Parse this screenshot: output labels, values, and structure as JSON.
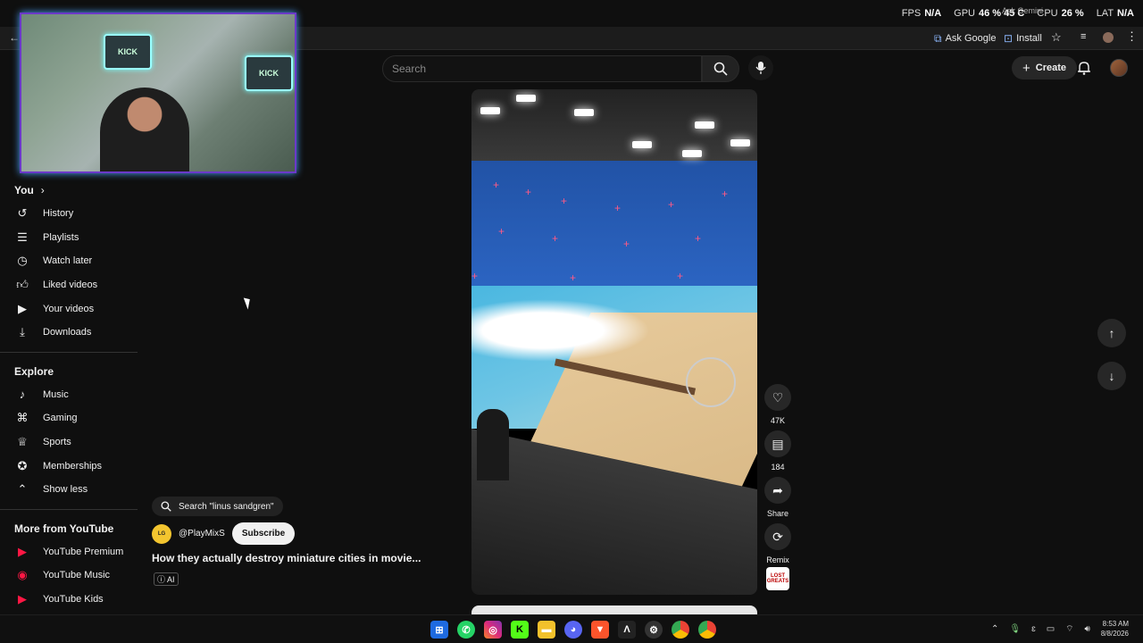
{
  "overlay": {
    "fps_label": "FPS",
    "fps_value": "N/A",
    "gpu_label": "GPU",
    "gpu_value": "46 % 45 C",
    "cpu_label": "CPU",
    "cpu_value": "26 %",
    "lat_label": "LAT",
    "lat_value": "N/A",
    "gemini": "Ask Gemini"
  },
  "browser": {
    "ask_google": "Ask Google",
    "install": "Install"
  },
  "header": {
    "search_placeholder": "Search",
    "create_label": "Create"
  },
  "webcam": {
    "sign1": "KICK",
    "sign2": "KICK"
  },
  "sidebar": {
    "you_title": "You",
    "you_items": [
      {
        "label": "History",
        "icon": "history-icon"
      },
      {
        "label": "Playlists",
        "icon": "playlists-icon"
      },
      {
        "label": "Watch later",
        "icon": "clock-icon"
      },
      {
        "label": "Liked videos",
        "icon": "thumbs-up-icon"
      },
      {
        "label": "Your videos",
        "icon": "video-icon"
      },
      {
        "label": "Downloads",
        "icon": "download-icon"
      }
    ],
    "explore_title": "Explore",
    "explore_items": [
      {
        "label": "Music",
        "icon": "music-icon"
      },
      {
        "label": "Gaming",
        "icon": "gaming-icon"
      },
      {
        "label": "Sports",
        "icon": "trophy-icon"
      },
      {
        "label": "Memberships",
        "icon": "memberships-icon"
      },
      {
        "label": "Show less",
        "icon": "chevron-up-icon"
      }
    ],
    "more_title": "More from YouTube",
    "more_items": [
      {
        "label": "YouTube Premium"
      },
      {
        "label": "YouTube Music"
      },
      {
        "label": "YouTube Kids"
      }
    ]
  },
  "short": {
    "search_chip": "Search \"linus sandgren\"",
    "channel": "@PlayMixS",
    "subscribe": "Subscribe",
    "title": "How they actually destroy miniature cities in movie...",
    "ai_badge": "AI",
    "likes": "47K",
    "comments": "184",
    "share": "Share",
    "remix": "Remix",
    "channel_thumb": "LOST GREATS"
  },
  "taskbar": {
    "time": "8:53 AM",
    "date": "8/8/2026"
  },
  "colors": {
    "accent": "#ff0000",
    "webcam_border": "#6b39c9",
    "chip_blue": "#8ab4f8"
  }
}
